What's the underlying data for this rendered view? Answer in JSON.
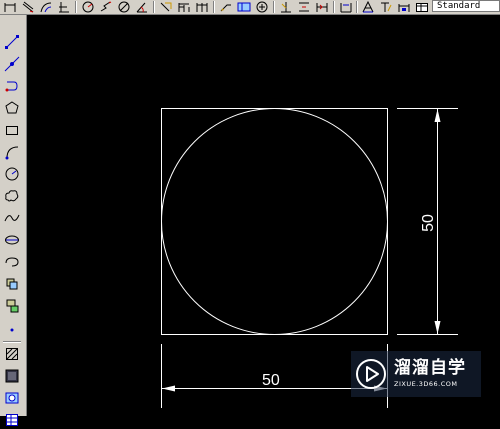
{
  "toolbar": {
    "text_style": "Standard",
    "icons": [
      "linear-dimension-icon",
      "aligned-dimension-icon",
      "arc-length-icon",
      "ordinate-icon",
      "radius-icon",
      "jogged-icon",
      "diameter-icon",
      "angular-icon",
      "quick-dimension-icon",
      "baseline-icon",
      "continue-icon",
      "leader-icon",
      "tolerance-icon",
      "center-mark-icon",
      "dimension-edit-icon",
      "dimension-text-edit-icon",
      "dimension-update-icon"
    ]
  },
  "draw_toolbar": {
    "icons": [
      "line-icon",
      "construction-line-icon",
      "polyline-icon",
      "polygon-icon",
      "rectangle-icon",
      "arc-icon",
      "circle-icon",
      "revision-cloud-icon",
      "spline-icon",
      "ellipse-icon",
      "ellipse-arc-icon",
      "insert-block-icon",
      "make-block-icon",
      "point-icon",
      "hatch-icon",
      "gradient-icon",
      "region-icon",
      "table-icon"
    ]
  },
  "drawing": {
    "horizontal_dimension": "50",
    "vertical_dimension": "50",
    "background": "#000000",
    "stroke": "#ffffff"
  },
  "watermark": {
    "title": "溜溜自学",
    "url": "ZIXUE.3D66.COM"
  }
}
